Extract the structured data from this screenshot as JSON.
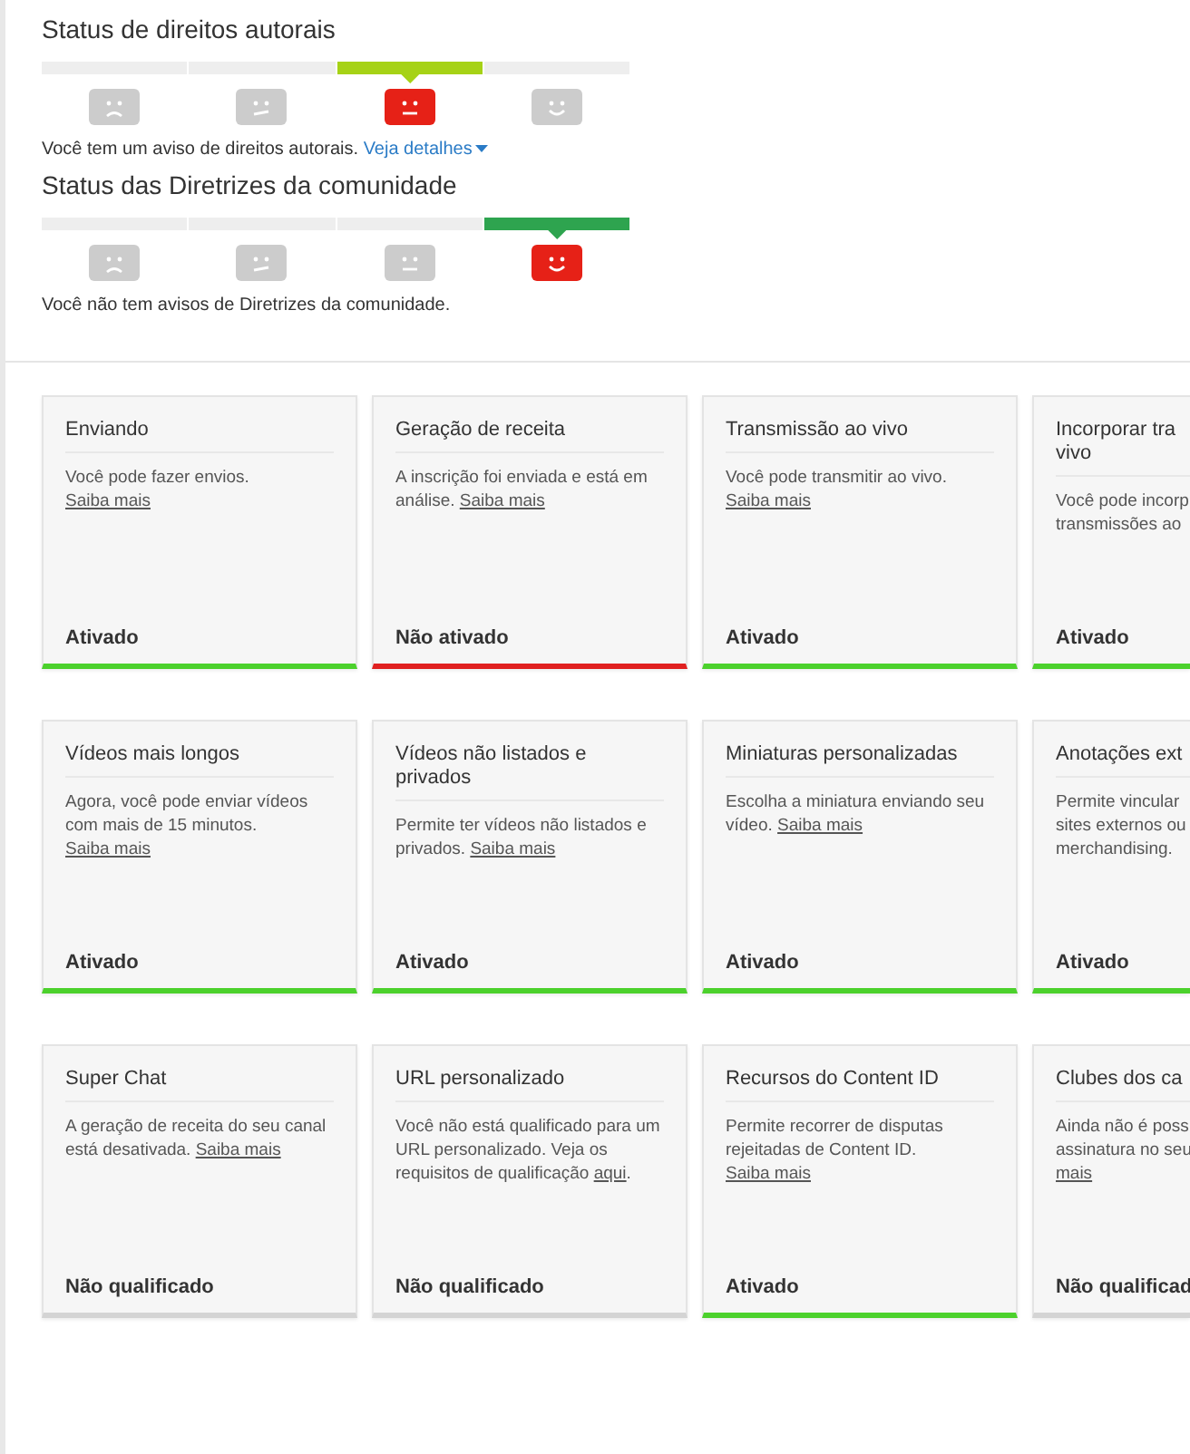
{
  "status_sections": [
    {
      "title": "Status de direitos autorais",
      "color": "#a6d216",
      "segments": [
        {
          "kind": "sad",
          "selected": false
        },
        {
          "kind": "meh",
          "selected": false
        },
        {
          "kind": "neutral",
          "selected": true
        },
        {
          "kind": "happy",
          "selected": false
        }
      ],
      "message": "Você tem um aviso de direitos autorais.",
      "details_link": "Veja detalhes"
    },
    {
      "title": "Status das Diretrizes da comunidade",
      "color": "#2ea44f",
      "segments": [
        {
          "kind": "sad",
          "selected": false
        },
        {
          "kind": "meh",
          "selected": false
        },
        {
          "kind": "neutral",
          "selected": false
        },
        {
          "kind": "happy",
          "selected": true
        }
      ],
      "message": "Você não tem avisos de Diretrizes da comunidade."
    }
  ],
  "feature_rows": [
    [
      {
        "title": [
          "Enviando"
        ],
        "description": [
          {
            "kind": "text",
            "text": "Você pode fazer envios. "
          },
          {
            "kind": "link",
            "text": "Saiba mais"
          }
        ],
        "status": "Ativado",
        "color": "#4cd12c"
      },
      {
        "title": [
          "Geração de receita"
        ],
        "description": [
          {
            "kind": "text",
            "text": "A inscrição foi enviada e está em análise. "
          },
          {
            "kind": "link",
            "text": "Saiba mais"
          }
        ],
        "status": "Não ativado",
        "color": "#e02020"
      },
      {
        "title": [
          "Transmissão ao vivo"
        ],
        "description": [
          {
            "kind": "text",
            "text": "Você pode transmitir ao vivo. "
          },
          {
            "kind": "link",
            "text": "Saiba mais"
          }
        ],
        "status": "Ativado",
        "color": "#4cd12c"
      },
      {
        "kind": "cut",
        "title": [
          "Incorporar tra",
          "vivo"
        ],
        "description": [
          {
            "kind": "text",
            "text": "Você pode incorp"
          },
          {
            "kind": "text",
            "text": "transmissões ao"
          }
        ],
        "status": "Ativado",
        "color": "#4cd12c"
      }
    ],
    [
      {
        "title": [
          "Vídeos mais longos"
        ],
        "description": [
          {
            "kind": "text",
            "text": "Agora, você pode enviar vídeos com mais de 15 minutos. "
          },
          {
            "kind": "link",
            "text": "Saiba mais"
          }
        ],
        "status": "Ativado",
        "color": "#4cd12c"
      },
      {
        "title": [
          "Vídeos não listados e privados"
        ],
        "description": [
          {
            "kind": "text",
            "text": "Permite ter vídeos não listados e privados. "
          },
          {
            "kind": "link",
            "text": "Saiba mais"
          }
        ],
        "status": "Ativado",
        "color": "#4cd12c"
      },
      {
        "title": [
          "Miniaturas personalizadas"
        ],
        "description": [
          {
            "kind": "text",
            "text": "Escolha a miniatura enviando seu vídeo. "
          },
          {
            "kind": "link",
            "text": "Saiba mais"
          }
        ],
        "status": "Ativado",
        "color": "#4cd12c"
      },
      {
        "kind": "cut",
        "title": [
          "Anotações ext"
        ],
        "description": [
          {
            "kind": "text",
            "text": "Permite vincular"
          },
          {
            "kind": "text",
            "text": "sites externos ou"
          },
          {
            "kind": "text",
            "text": "merchandising."
          }
        ],
        "status": "Ativado",
        "color": "#4cd12c"
      }
    ],
    [
      {
        "title": [
          "Super Chat"
        ],
        "description": [
          {
            "kind": "text",
            "text": "A geração de receita do seu canal está desativada. "
          },
          {
            "kind": "link",
            "text": "Saiba mais"
          }
        ],
        "status": "Não qualificado",
        "color": "#d4d4d4"
      },
      {
        "title": [
          "URL personalizado"
        ],
        "description": [
          {
            "kind": "text",
            "text": "Você não está qualificado para um URL personalizado. Veja os requisitos de qualificação "
          },
          {
            "kind": "link",
            "text": "aqui"
          },
          {
            "kind": "text",
            "text": "."
          }
        ],
        "status": "Não qualificado",
        "color": "#d4d4d4"
      },
      {
        "title": [
          "Recursos do Content ID"
        ],
        "description": [
          {
            "kind": "text",
            "text": "Permite recorrer de disputas rejeitadas de Content ID. "
          },
          {
            "kind": "link",
            "text": "Saiba mais"
          }
        ],
        "status": "Ativado",
        "color": "#4cd12c"
      },
      {
        "kind": "cut",
        "title": [
          "Clubes dos ca"
        ],
        "description": [
          {
            "kind": "text",
            "text": "Ainda não é poss"
          },
          {
            "kind": "text",
            "text": "assinatura no seu"
          },
          {
            "kind": "link",
            "text": "mais"
          }
        ],
        "status": "Não qualificad",
        "color": "#d4d4d4"
      }
    ]
  ]
}
